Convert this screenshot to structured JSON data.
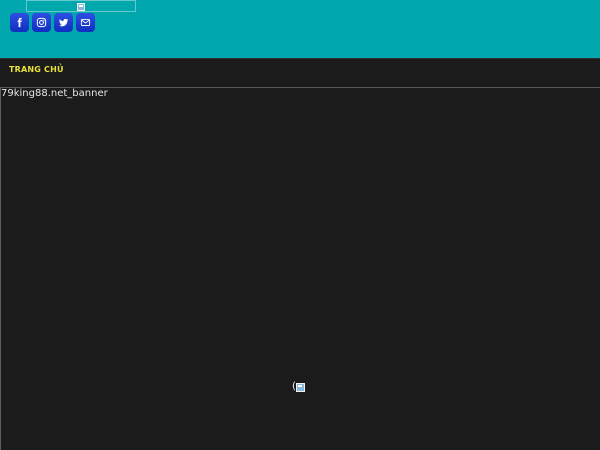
{
  "header": {
    "background_color": "#00a8ad",
    "logo_image": "broken-image-icon",
    "social": [
      {
        "name": "facebook",
        "icon": "facebook-icon"
      },
      {
        "name": "instagram",
        "icon": "instagram-icon"
      },
      {
        "name": "twitter",
        "icon": "twitter-icon"
      },
      {
        "name": "email",
        "icon": "envelope-icon"
      }
    ],
    "social_color": "#1f3fd6"
  },
  "nav": {
    "items": [
      {
        "label": "TRANG CHỦ"
      }
    ],
    "item_color": "#e8e03a"
  },
  "main": {
    "banner_alt": "79king88.net_banner",
    "loader_text": "(",
    "loader_icon": "broken-image-icon",
    "background_color": "#1b1b1b"
  }
}
